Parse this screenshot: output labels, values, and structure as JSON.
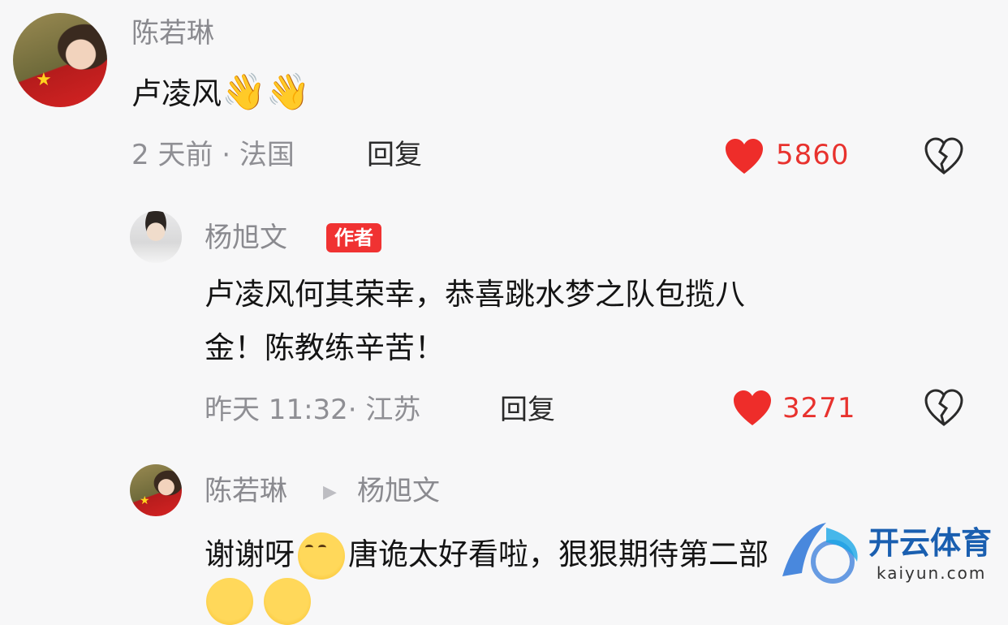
{
  "comments": [
    {
      "user": "陈若琳",
      "text": "卢凌风",
      "time": "2 天前 · 法国",
      "reply_label": "回复",
      "likes": "5860"
    },
    {
      "user": "杨旭文",
      "badge": "作者",
      "text_line1": "卢凌风何其荣幸，恭喜跳水梦之队包揽八",
      "text_line2": "金！陈教练辛苦！",
      "time": "昨天 11:32· 江苏",
      "reply_label": "回复",
      "likes": "3271"
    },
    {
      "user": "陈若琳",
      "reply_to": "杨旭文",
      "text_a": "谢谢呀",
      "text_b": "唐诡太好看啦，狠狠期待第二部"
    }
  ],
  "watermark": {
    "name": "开云体育",
    "url": "kaiyun.com"
  },
  "colors": {
    "like": "#e8322e",
    "badge": "#f03232",
    "background": "#f7f7f8"
  },
  "icons": [
    "heart-icon",
    "dislike-icon",
    "waving-hand-icon",
    "smiling-face-icon",
    "laughing-face-icon"
  ]
}
